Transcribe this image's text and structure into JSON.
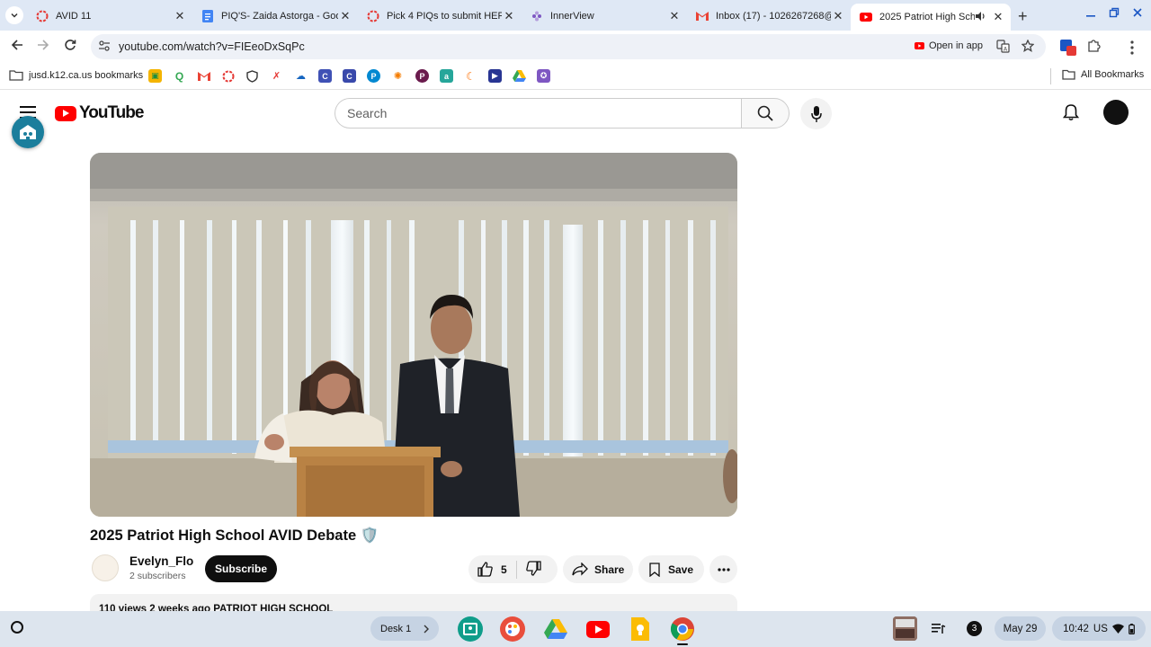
{
  "browser": {
    "tabs": [
      {
        "title": "AVID 11",
        "icon": "red-ring-icon"
      },
      {
        "title": "PIQ'S- Zaida Astorga - Goo",
        "icon": "docs-icon"
      },
      {
        "title": "Pick 4 PIQs to submit HER",
        "icon": "red-ring-icon"
      },
      {
        "title": "InnerView",
        "icon": "innerview-icon"
      },
      {
        "title": "Inbox (17) - 1026267268@",
        "icon": "gmail-icon"
      },
      {
        "title": "2025 Patriot High Scho",
        "icon": "youtube-icon",
        "active": true
      }
    ],
    "new_tab": "+",
    "url": "youtube.com/watch?v=FIEeoDxSqPc",
    "open_in_app": "Open in app",
    "bookmarks_folder": "jusd.k12.ca.us bookmarks",
    "all_bookmarks": "All Bookmarks"
  },
  "youtube": {
    "logo_text": "YouTube",
    "search_placeholder": "Search",
    "video": {
      "title": "2025 Patriot High School AVID Debate 🛡️",
      "channel": "Evelyn_Flo",
      "subscribers": "2 subscribers",
      "subscribe_label": "Subscribe",
      "likes": "5",
      "share_label": "Share",
      "save_label": "Save",
      "meta": "110 views  2 weeks ago  PATRIOT HIGH SCHOOL"
    }
  },
  "shelf": {
    "desk_label": "Desk 1",
    "notification_count": "3",
    "date": "May 29",
    "time": "10:42",
    "locale": "US"
  },
  "colors": {
    "youtube_red": "#ff0000",
    "tabstrip": "#dfe8f5",
    "shelf": "#dde5ee",
    "accent_blue": "#1a56c4"
  }
}
